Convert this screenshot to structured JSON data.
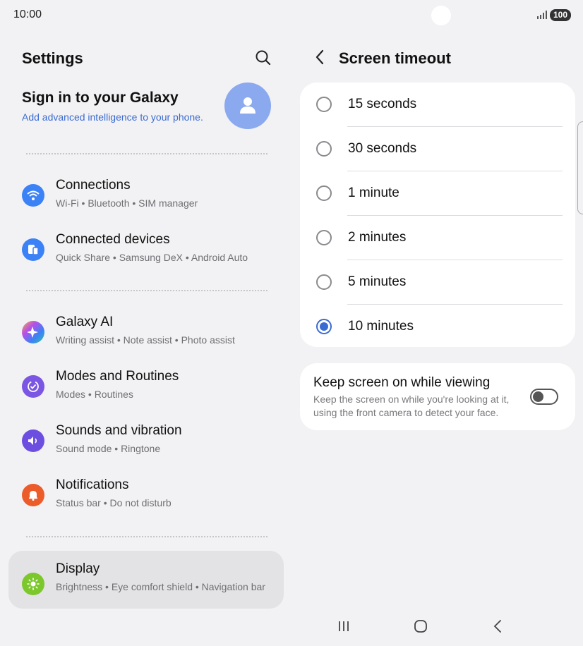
{
  "status_bar": {
    "time": "10:00",
    "battery": "100"
  },
  "settings": {
    "title": "Settings",
    "account": {
      "title": "Sign in to your Galaxy",
      "subtitle": "Add advanced intelligence to your phone."
    },
    "items": [
      {
        "label": "Connections",
        "sub": "Wi-Fi  •  Bluetooth  •  SIM manager",
        "icon": "wifi-icon",
        "color": "#3b82f6"
      },
      {
        "label": "Connected devices",
        "sub": "Quick Share  •  Samsung DeX  •  Android Auto",
        "icon": "devices-icon",
        "color": "#3b82f6"
      },
      {
        "label": "Galaxy AI",
        "sub": "Writing assist  •  Note assist  •  Photo assist",
        "icon": "sparkle-icon",
        "color": "#6b5be8"
      },
      {
        "label": "Modes and Routines",
        "sub": "Modes  •  Routines",
        "icon": "routine-icon",
        "color": "#7b55e3"
      },
      {
        "label": "Sounds and vibration",
        "sub": "Sound mode  •  Ringtone",
        "icon": "speaker-icon",
        "color": "#6c4fe0"
      },
      {
        "label": "Notifications",
        "sub": "Status bar  •  Do not disturb",
        "icon": "bell-icon",
        "color": "#ec5b2a"
      },
      {
        "label": "Display",
        "sub": "Brightness  •  Eye comfort shield  •  Navigation bar",
        "icon": "sun-icon",
        "color": "#7cc72c"
      }
    ]
  },
  "timeout": {
    "title": "Screen timeout",
    "options": [
      {
        "label": "15 seconds",
        "checked": false
      },
      {
        "label": "30 seconds",
        "checked": false
      },
      {
        "label": "1 minute",
        "checked": false
      },
      {
        "label": "2 minutes",
        "checked": false
      },
      {
        "label": "5 minutes",
        "checked": false
      },
      {
        "label": "10 minutes",
        "checked": true
      }
    ],
    "keep_screen": {
      "title": "Keep screen on while viewing",
      "description": "Keep the screen on while you're looking at it, using the front camera to detect your face.",
      "enabled": false
    }
  },
  "colors": {
    "accent": "#3a6bd1",
    "background": "#f2f2f4",
    "card": "#ffffff"
  }
}
